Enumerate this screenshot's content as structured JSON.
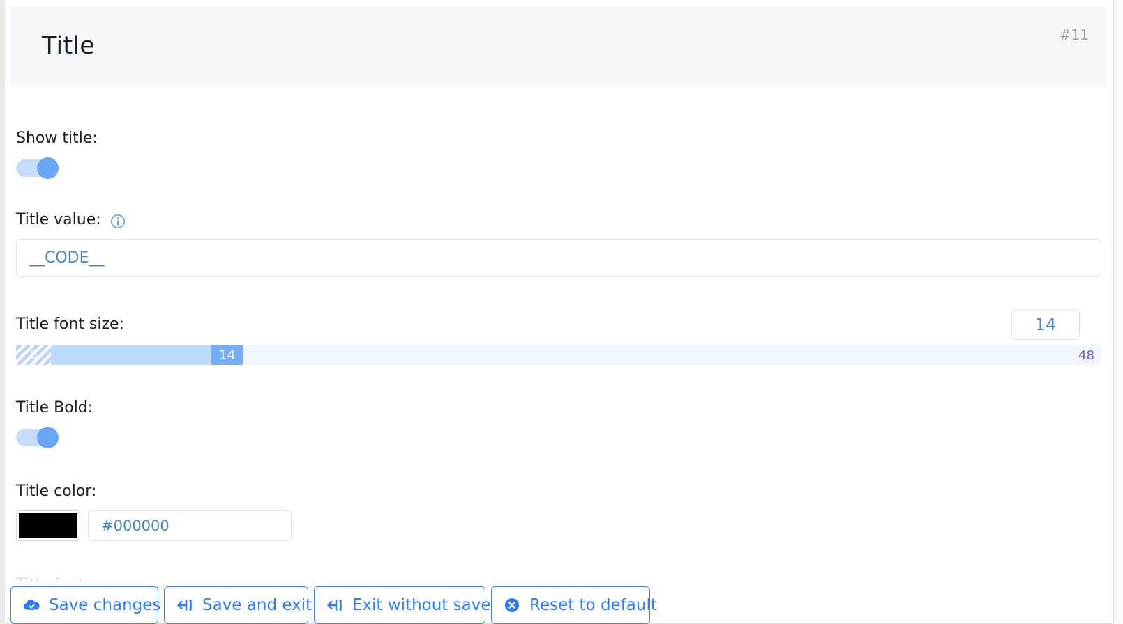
{
  "header": {
    "title": "Title",
    "reference_id": "#11"
  },
  "fields": {
    "show_title": {
      "label": "Show title:",
      "toggle_state": "on"
    },
    "title_value": {
      "label": "Title value:",
      "info_icon": "info-circle-icon",
      "value": "__CODE__",
      "placeholder": "__CODE__"
    },
    "title_font_size": {
      "label": "Title font size:",
      "value": "14",
      "slider_min_label": "8",
      "slider_max_label": "48",
      "slider_current": "14"
    },
    "title_bold": {
      "label": "Title Bold:",
      "toggle_state": "on"
    },
    "title_color": {
      "label": "Title color:",
      "swatch_color": "#000000",
      "value": "#000000",
      "placeholder": "#000000"
    },
    "title_font": {
      "label": "Title font:"
    }
  },
  "buttons": [
    {
      "label": "Save changes",
      "icon": "cloud-check-icon"
    },
    {
      "label": "Save and exit",
      "icon": "arrow-left-bracket-icon"
    },
    {
      "label": "Exit without save",
      "icon": "arrow-left-bracket-icon"
    },
    {
      "label": "Reset to default",
      "icon": "circle-x-icon"
    }
  ],
  "colors": {
    "accent_blue": "#2f7cf6",
    "toggle_knob": "#6aa6f7",
    "toggle_track": "#c5ddfb",
    "slider_handle": "#74aef9",
    "slider_fill": "#bcdafc",
    "slider_track": "#eff6fd",
    "max_label": "#6f55d4",
    "input_text": "#4a85c4",
    "header_bg": "#f6f7fb",
    "ref_id": "#9aa0ab"
  }
}
